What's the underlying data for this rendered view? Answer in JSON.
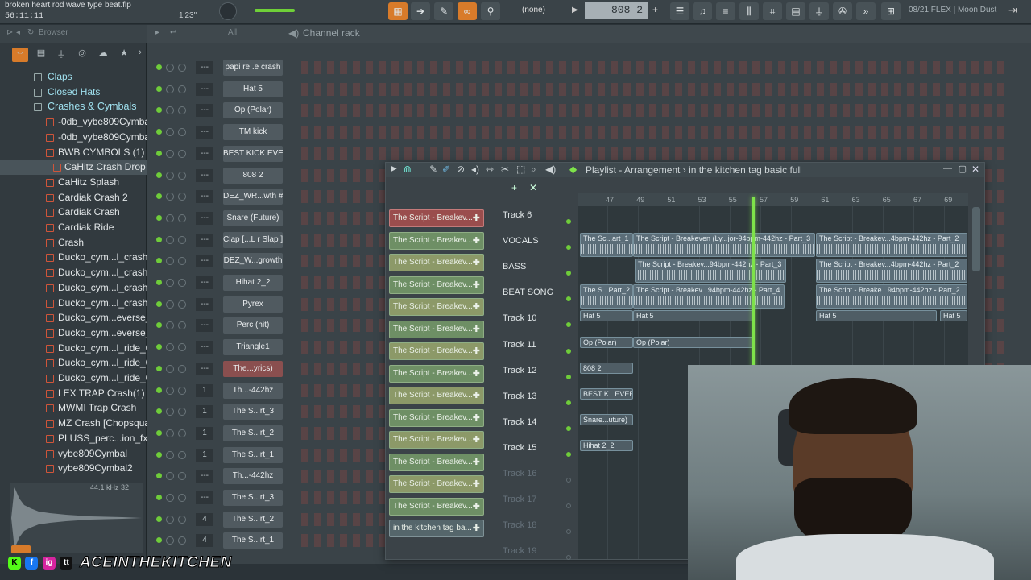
{
  "topbar": {
    "title": "broken heart rod wave type beat.flp",
    "time": "56:11:11",
    "small_tempo": "1'23\"",
    "pattern_select": "(none)",
    "pattern_number": "808 2",
    "hint": "08/21  FLEX | Moon Dust"
  },
  "browser": {
    "title": "Browser",
    "filter": "All",
    "items": [
      {
        "label": "Claps",
        "type": "folder"
      },
      {
        "label": "Closed Hats",
        "type": "folder"
      },
      {
        "label": "Crashes & Cymbals",
        "type": "folder-open"
      },
      {
        "label": "-0db_vybe809Cymbal",
        "type": "file"
      },
      {
        "label": "-0db_vybe809Cymbal2",
        "type": "file"
      },
      {
        "label": "BWB CYMBOLS (1)",
        "type": "file"
      },
      {
        "label": "CaHitz Crash Drop",
        "type": "file-selected"
      },
      {
        "label": "CaHitz Splash",
        "type": "file"
      },
      {
        "label": "Cardiak Crash 2",
        "type": "file"
      },
      {
        "label": "Cardiak Crash",
        "type": "file"
      },
      {
        "label": "Cardiak Ride",
        "type": "file"
      },
      {
        "label": "Crash",
        "type": "file"
      },
      {
        "label": "Ducko_cym...l_crash_01",
        "type": "file"
      },
      {
        "label": "Ducko_cym...l_crash_02",
        "type": "file"
      },
      {
        "label": "Ducko_cym...l_crash_03",
        "type": "file"
      },
      {
        "label": "Ducko_cym...l_crash_04",
        "type": "file"
      },
      {
        "label": "Ducko_cym...everse_01",
        "type": "file"
      },
      {
        "label": "Ducko_cym...everse_02",
        "type": "file"
      },
      {
        "label": "Ducko_cym...l_ride_01",
        "type": "file"
      },
      {
        "label": "Ducko_cym...l_ride_02",
        "type": "file"
      },
      {
        "label": "Ducko_cym...l_ride_03",
        "type": "file"
      },
      {
        "label": "LEX TRAP Crash(1)",
        "type": "file"
      },
      {
        "label": "MWMI Trap Crash",
        "type": "file"
      },
      {
        "label": "MZ Crash [Chopsquad]",
        "type": "file"
      },
      {
        "label": "PLUSS_perc...ion_fx_06",
        "type": "file"
      },
      {
        "label": "vybe809Cymbal",
        "type": "file"
      },
      {
        "label": "vybe809Cymbal2",
        "type": "file"
      }
    ],
    "waveform_info": "44.1 kHz 32"
  },
  "rack": {
    "title": "Channel rack",
    "filter": "All",
    "channels": [
      {
        "num": "---",
        "name": "papi re..e crash"
      },
      {
        "num": "---",
        "name": "Hat 5"
      },
      {
        "num": "---",
        "name": "Op (Polar)"
      },
      {
        "num": "---",
        "name": "TM kick"
      },
      {
        "num": "---",
        "name": "BEST KICK EVER"
      },
      {
        "num": "---",
        "name": "808 2"
      },
      {
        "num": "---",
        "name": "DEZ_WR...wth #2"
      },
      {
        "num": "---",
        "name": "Snare (Future)"
      },
      {
        "num": "---",
        "name": "Clap [...L r Slap ]"
      },
      {
        "num": "---",
        "name": "DEZ_W...growth"
      },
      {
        "num": "---",
        "name": "Hihat 2_2"
      },
      {
        "num": "---",
        "name": "Pyrex"
      },
      {
        "num": "---",
        "name": "Perc (hit)"
      },
      {
        "num": "---",
        "name": "Triangle1"
      },
      {
        "num": "---",
        "name": "The...yrics)"
      },
      {
        "num": "1",
        "name": "Th...-442hz"
      },
      {
        "num": "1",
        "name": "The S...rt_3"
      },
      {
        "num": "1",
        "name": "The S...rt_2"
      },
      {
        "num": "1",
        "name": "The S...rt_1"
      },
      {
        "num": "---",
        "name": "Th...-442hz"
      },
      {
        "num": "---",
        "name": "The S...rt_3"
      },
      {
        "num": "4",
        "name": "The S...rt_2"
      },
      {
        "num": "4",
        "name": "The S...rt_1"
      }
    ]
  },
  "playlist": {
    "title": "Playlist - Arrangement",
    "arrangement": "in the kitchen tag basic full",
    "patterns": [
      "The Script - Breakev...",
      "The Script - Breakev...",
      "The Script - Breakev...",
      "The Script - Breakev...",
      "The Script - Breakev...",
      "The Script - Breakev...",
      "The Script - Breakev...",
      "The Script - Breakev...",
      "The Script - Breakev...",
      "The Script - Breakev...",
      "The Script - Breakev...",
      "The Script - Breakev...",
      "The Script - Breakev...",
      "The Script - Breakev...",
      "in the kitchen tag ba..."
    ],
    "ruler": [
      "47",
      "49",
      "51",
      "53",
      "55",
      "57",
      "59",
      "61",
      "63",
      "65",
      "67",
      "69"
    ],
    "tracks": [
      {
        "name": "Track 6",
        "active": true
      },
      {
        "name": "VOCALS",
        "active": true
      },
      {
        "name": "BASS",
        "active": true
      },
      {
        "name": "BEAT SONG",
        "active": true
      },
      {
        "name": "Track 10",
        "active": true
      },
      {
        "name": "Track 11",
        "active": true
      },
      {
        "name": "Track 12",
        "active": true
      },
      {
        "name": "Track 13",
        "active": true
      },
      {
        "name": "Track 14",
        "active": true
      },
      {
        "name": "Track 15",
        "active": true
      },
      {
        "name": "Track 16",
        "active": false
      },
      {
        "name": "Track 17",
        "active": false
      },
      {
        "name": "Track 18",
        "active": false
      },
      {
        "name": "Track 19",
        "active": false
      }
    ],
    "clips": {
      "vocals_1": "The Sc...art_1",
      "vocals_2": "The Script - Breakeven (Ly...jor-94bpm-442hz - Part_3",
      "vocals_3": "The Script - Breakev...4bpm-442hz - Part_2",
      "bass_1": "The Script - Breakev...94bpm-442hz - Part_3",
      "bass_2": "The Script - Breakev...4bpm-442hz - Part_2",
      "beat_1": "The S...Part_2",
      "beat_2": "The Script - Breakev...94bpm-442hz - Part_4",
      "beat_3": "The Script - Breake...94bpm-442hz - Part_2",
      "t10_1": "Hat 5",
      "t10_2": "Hat 5",
      "t10_3": "Hat 5",
      "t10_4": "Hat 5",
      "t11_1": "Op (Polar)",
      "t11_2": "Op (Polar)",
      "t12_1": "808 2",
      "t13_1": "BEST K...EVER",
      "t14_1": "Snare...uture)",
      "t15_1": "Hihat 2_2"
    }
  },
  "social": {
    "handle": "ACEINTHEKITCHEN",
    "icons": [
      "K",
      "f",
      "ig",
      "tt"
    ]
  }
}
